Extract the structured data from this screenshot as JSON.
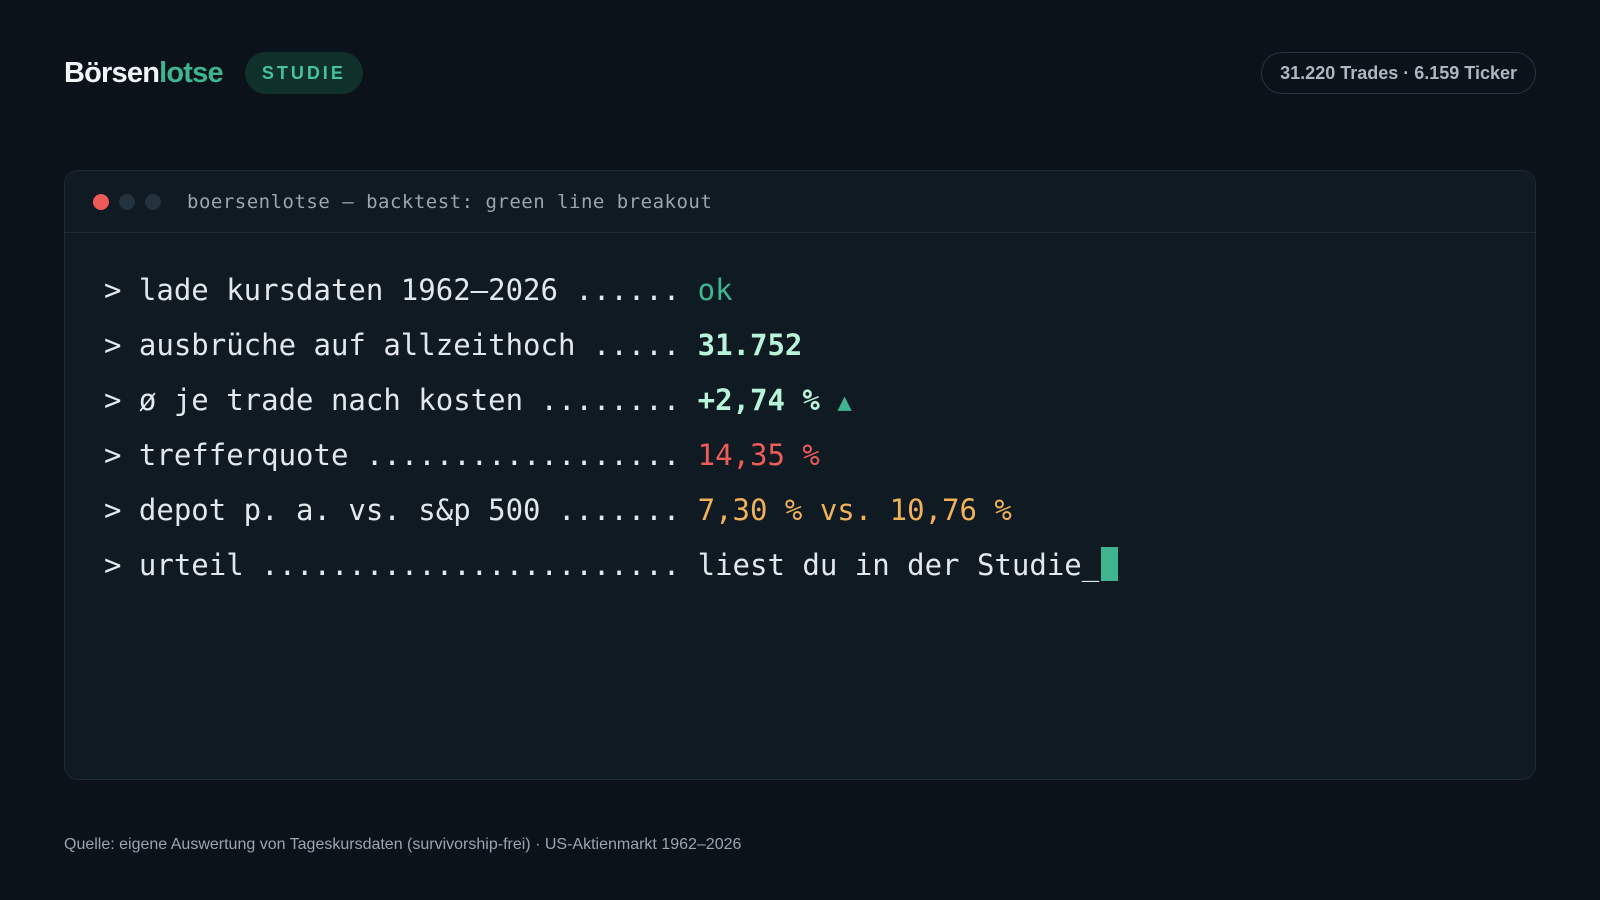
{
  "header": {
    "brand_part1": "Börsen",
    "brand_part2": "lotse",
    "badge": "STUDIE",
    "stats": "31.220 Trades · 6.159 Ticker"
  },
  "terminal": {
    "title": "boersenlotse — backtest: green line breakout",
    "lines": [
      {
        "label": "> lade kursdaten 1962–2026 ...... ",
        "value": "ok"
      },
      {
        "label": "> ausbrüche auf allzeithoch ..... ",
        "value": "31.752"
      },
      {
        "label": "> ø je trade nach kosten ........ ",
        "value": "+2,74 %",
        "icon": "triangle-up-icon"
      },
      {
        "label": "> trefferquote .................. ",
        "value": "14,35 %"
      },
      {
        "label": "> depot p. a. vs. s&p 500 ....... ",
        "value": "7,30 % vs. 10,76 %"
      },
      {
        "label": "> urteil ........................ ",
        "value": "liest du in der Studie_"
      }
    ]
  },
  "footer": {
    "source": "Quelle: eigene Auswertung von Tageskursdaten (survivorship-frei) · US-Aktienmarkt 1962–2026"
  },
  "colors": {
    "background": "#0b121a",
    "accent_green": "#3fb58f",
    "highlight_mint": "#b9f3da",
    "negative_red": "#ee5b59",
    "amber": "#f0b15a"
  }
}
